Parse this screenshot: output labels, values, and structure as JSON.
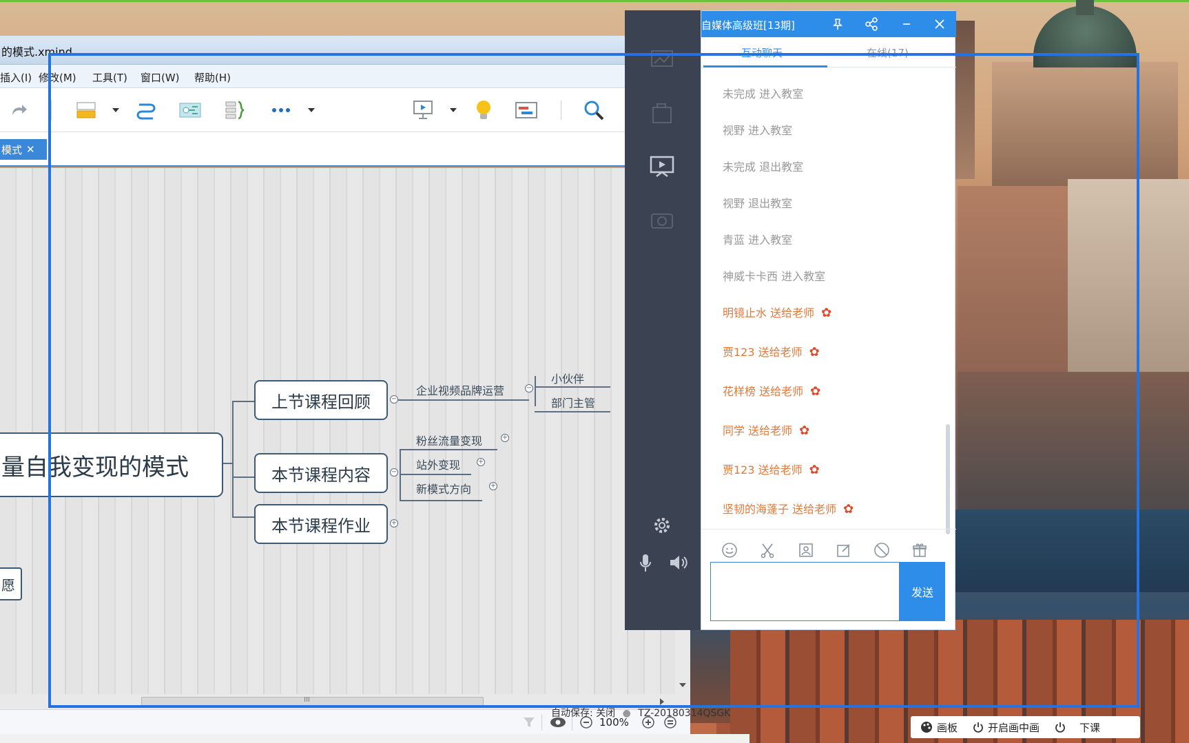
{
  "xmind": {
    "window_title": "的模式.xmind",
    "menu": [
      "插入(I)",
      "修改(M)",
      "工具(T)",
      "窗口(W)",
      "帮助(H)"
    ],
    "tab_label": "模式",
    "zoom": "100%",
    "autosave": "自动保存: 关闭",
    "computer_name": "TZ-20180314QSGK",
    "scroll_marker": "III",
    "mindmap": {
      "central": "量自我变现的模式",
      "left_partial": "愿",
      "branches": [
        {
          "label": "上节课程回顾",
          "children": [
            {
              "label": "企业视频品牌运营",
              "children": [
                "小伙伴",
                "部门主管"
              ]
            }
          ]
        },
        {
          "label": "本节课程内容",
          "children": [
            {
              "label": "粉丝流量变现"
            },
            {
              "label": "站外变现"
            },
            {
              "label": "新模式方向"
            }
          ]
        },
        {
          "label": "本节课程作业",
          "children": []
        }
      ]
    }
  },
  "chat": {
    "title": "自媒体高级班[13期]",
    "tabs": [
      "互动聊天",
      "在线(17)"
    ],
    "messages": [
      {
        "text": "未完成 进入教室",
        "gift": false
      },
      {
        "text": "视野 进入教室",
        "gift": false
      },
      {
        "text": "未完成 退出教室",
        "gift": false
      },
      {
        "text": "视野 退出教室",
        "gift": false
      },
      {
        "text": "青蓝 进入教室",
        "gift": false
      },
      {
        "text": "神威卡卡西 进入教室",
        "gift": false
      },
      {
        "text": "明镜止水 送给老师",
        "gift": true
      },
      {
        "text": "贾123 送给老师",
        "gift": true
      },
      {
        "text": "花样榜 送给老师",
        "gift": true
      },
      {
        "text": "同学 送给老师",
        "gift": true
      },
      {
        "text": "贾123 送给老师",
        "gift": true
      },
      {
        "text": "坚韧的海蓬子 送给老师",
        "gift": true
      }
    ],
    "send_label": "发送",
    "tools": [
      "emoji-icon",
      "scissors-icon",
      "image-icon",
      "edit-icon",
      "block-icon",
      "gift-icon"
    ]
  },
  "bottom_bar": {
    "items": [
      "画板",
      "开启画中画",
      "下课"
    ]
  },
  "colors": {
    "accent": "#2e8de8",
    "frame": "#2573e0",
    "gift_text": "#e07a3a",
    "side_panel": "#3b4352"
  }
}
